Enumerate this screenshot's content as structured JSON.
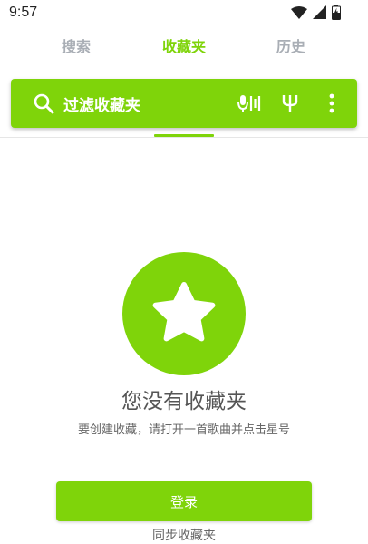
{
  "status_bar": {
    "time": "9:57",
    "icons": [
      "wifi-icon",
      "cellular-icon",
      "battery-charging-icon"
    ]
  },
  "tabs": [
    {
      "label": "搜索",
      "active": false
    },
    {
      "label": "收藏夹",
      "active": true
    },
    {
      "label": "历史",
      "active": false
    }
  ],
  "toolbar": {
    "title": "过滤收藏夹",
    "icons": [
      "search-icon",
      "mic-equalizer-icon",
      "tuning-fork-icon",
      "more-vert-icon"
    ]
  },
  "empty_state": {
    "icon": "star-icon",
    "title": "您没有收藏夹",
    "subtitle": "要创建收藏，请打开一首歌曲并点击星号"
  },
  "actions": {
    "login_label": "登录",
    "sync_text": "同步收藏夹"
  },
  "colors": {
    "accent": "#7fd40a",
    "tab_inactive": "#a9aeb5"
  }
}
